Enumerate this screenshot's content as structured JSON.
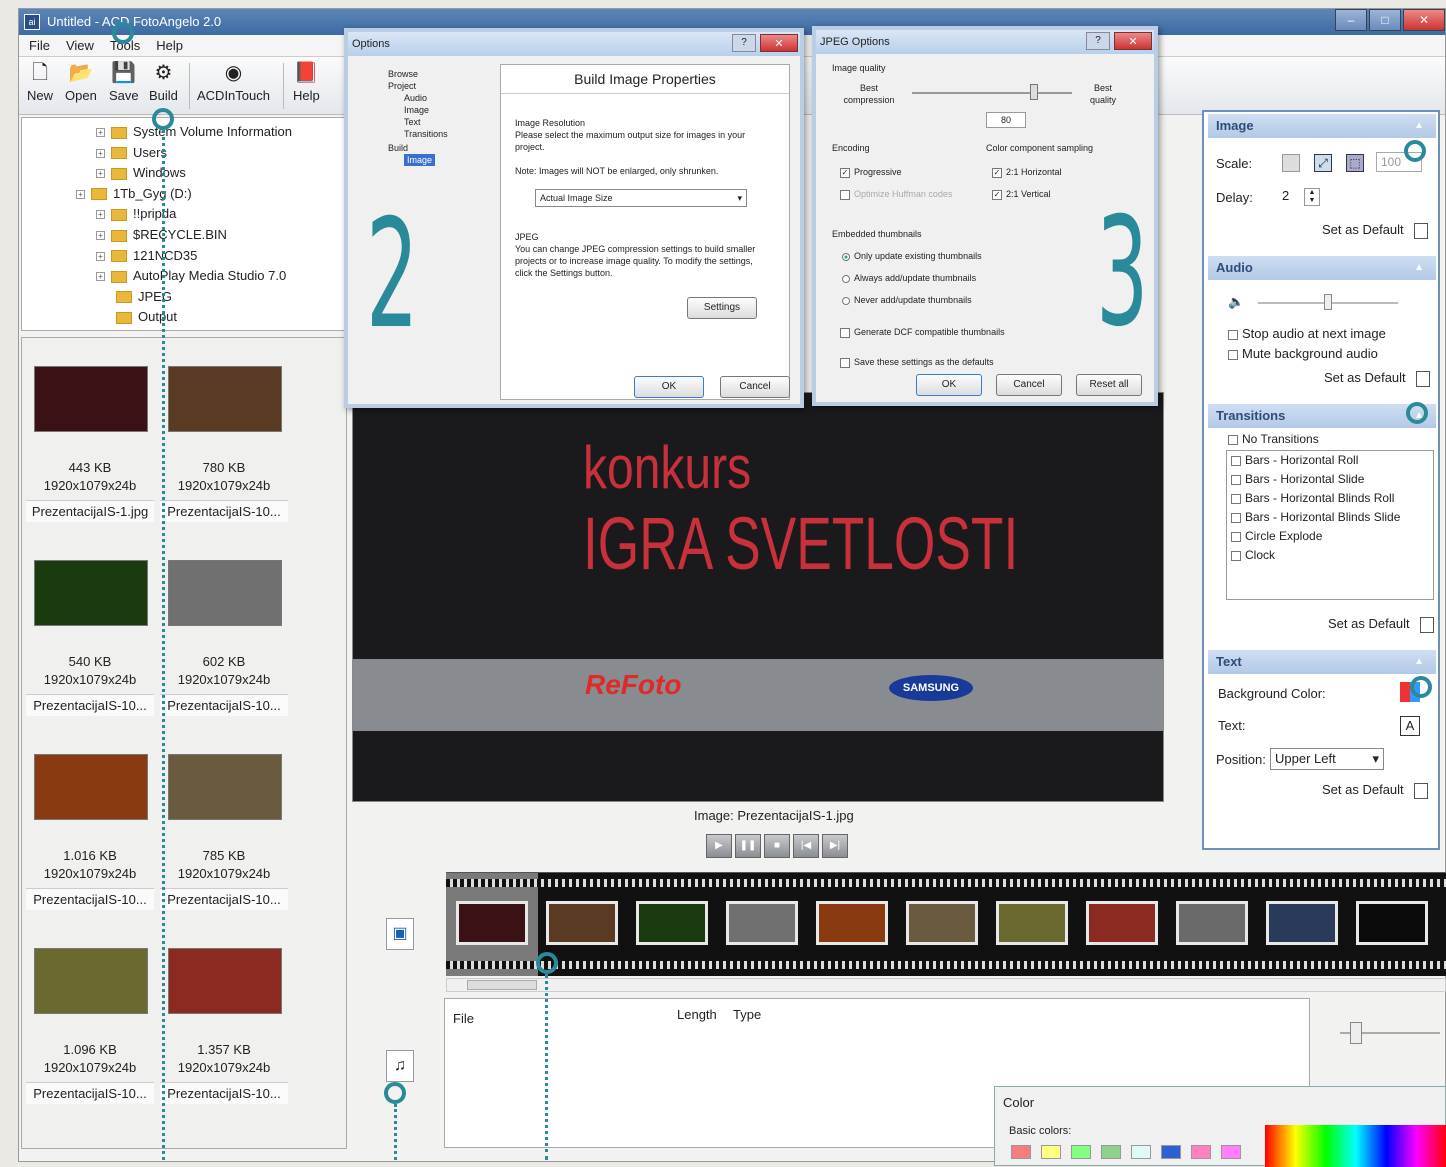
{
  "window": {
    "title": "Untitled - ACD FotoAngelo 2.0",
    "controls": [
      "–",
      "□",
      "✕"
    ]
  },
  "menu": [
    "File",
    "View",
    "Tools",
    "Help"
  ],
  "toolbar": {
    "buttons": [
      {
        "label": "New",
        "icon": "new-document-icon"
      },
      {
        "label": "Open",
        "icon": "open-folder-icon"
      },
      {
        "label": "Save",
        "icon": "save-disk-icon"
      },
      {
        "label": "Build",
        "icon": "build-icon"
      },
      {
        "label": "ACDInTouch",
        "icon": "acdintouch-icon"
      },
      {
        "label": "Help",
        "icon": "help-book-icon"
      }
    ]
  },
  "tree": {
    "items": [
      {
        "label": "System Volume Information",
        "indent": 1
      },
      {
        "label": "Users",
        "indent": 1
      },
      {
        "label": "Windows",
        "indent": 1
      },
      {
        "label": "1Tb_Gyg (D:)",
        "indent": 0
      },
      {
        "label": "!!pripda",
        "indent": 1
      },
      {
        "label": "$RECYCLE.BIN",
        "indent": 1
      },
      {
        "label": "121NCD35",
        "indent": 1
      },
      {
        "label": "AutoPlay Media Studio 7.0",
        "indent": 1
      },
      {
        "label": "JPEG",
        "indent": 2
      },
      {
        "label": "Output",
        "indent": 2
      }
    ]
  },
  "thumbnails": [
    {
      "size": "443 KB",
      "dims": "1920x1079x24b",
      "name": "PrezentacijaIS-1.jpg",
      "color": "#3a1216"
    },
    {
      "size": "780 KB",
      "dims": "1920x1079x24b",
      "name": "PrezentacijaIS-10...",
      "color": "#5a3a22"
    },
    {
      "size": "540 KB",
      "dims": "1920x1079x24b",
      "name": "PrezentacijaIS-10...",
      "color": "#1a3a10"
    },
    {
      "size": "602 KB",
      "dims": "1920x1079x24b",
      "name": "PrezentacijaIS-10...",
      "color": "#707070"
    },
    {
      "size": "1.016 KB",
      "dims": "1920x1079x24b",
      "name": "PrezentacijaIS-10...",
      "color": "#8a3a10"
    },
    {
      "size": "785 KB",
      "dims": "1920x1079x24b",
      "name": "PrezentacijaIS-10...",
      "color": "#6a5a40"
    },
    {
      "size": "1.096 KB",
      "dims": "1920x1079x24b",
      "name": "PrezentacijaIS-10...",
      "color": "#6a6a30"
    },
    {
      "size": "1.357 KB",
      "dims": "1920x1079x24b",
      "name": "PrezentacijaIS-10...",
      "color": "#8a2a20"
    }
  ],
  "preview": {
    "line1": "konkurs",
    "line2": "IGRA SVETLOSTI",
    "brand1": "ReFoto",
    "brand2": "SAMSUNG",
    "caption": "Image: PrezentacijaIS-1.jpg"
  },
  "playback": {
    "buttons": [
      "▶",
      "❚❚",
      "■",
      "|◀",
      "▶|"
    ]
  },
  "options_dialog": {
    "title": "Options",
    "tree": [
      "Browse",
      "Project",
      "Audio",
      "Image",
      "Text",
      "Transitions",
      "Build",
      "Image"
    ],
    "heading": "Build Image Properties",
    "res_label": "Image Resolution",
    "res_desc": "Please select the maximum output size for images in your project.",
    "note": "Note: Images will NOT be enlarged, only shrunken.",
    "select": "Actual Image Size",
    "jpeg_label": "JPEG",
    "jpeg_desc": "You can change JPEG compression settings to build smaller projects or to increase image quality. To modify the settings, click the Settings button.",
    "settings_btn": "Settings",
    "ok": "OK",
    "cancel": "Cancel",
    "marker": "2"
  },
  "jpeg_dialog": {
    "title": "JPEG Options",
    "quality_label": "Image quality",
    "best_compression": "Best compression",
    "best_quality": "Best quality",
    "quality_value": "80",
    "encoding": "Encoding",
    "progressive": "Progressive",
    "optimize": "Optimize Huffman codes",
    "sampling": "Color component sampling",
    "h": "2:1 Horizontal",
    "v": "2:1 Vertical",
    "embedded": "Embedded thumbnails",
    "r1": "Only update existing thumbnails",
    "r2": "Always add/update thumbnails",
    "r3": "Never add/update thumbnails",
    "dcf": "Generate DCF compatible thumbnails",
    "save_defaults": "Save these settings as the defaults",
    "ok": "OK",
    "cancel": "Cancel",
    "reset": "Reset all",
    "marker": "3"
  },
  "right_panel": {
    "image": {
      "header": "Image",
      "scale_label": "Scale:",
      "scale_value": "100",
      "delay_label": "Delay:",
      "delay_value": "2",
      "set_default": "Set as Default"
    },
    "audio": {
      "header": "Audio",
      "stop": "Stop audio at next image",
      "mute": "Mute background audio",
      "set_default": "Set as Default"
    },
    "transitions": {
      "header": "Transitions",
      "none": "No Transitions",
      "items": [
        "Bars - Horizontal Roll",
        "Bars - Horizontal Slide",
        "Bars - Horizontal Blinds Roll",
        "Bars - Horizontal Blinds Slide",
        "Circle Explode",
        "Clock"
      ],
      "set_default": "Set as Default"
    },
    "text": {
      "header": "Text",
      "bg_label": "Background Color:",
      "text_label": "Text:",
      "text_icon": "A",
      "pos_label": "Position:",
      "pos_value": "Upper Left",
      "set_default": "Set as Default"
    }
  },
  "audio_pane": {
    "col_file": "File",
    "col_length": "Length",
    "col_type": "Type"
  },
  "color_dialog": {
    "title": "Color",
    "basic": "Basic colors:",
    "swatches": [
      "#f28080",
      "#ffff80",
      "#80ff80",
      "#8fd08f",
      "#dff8f8",
      "#3060d0",
      "#ff80c0",
      "#ff80ff"
    ]
  },
  "filmstrip": {
    "colors": [
      "#3a1216",
      "#5a3a22",
      "#1a3a10",
      "#707070",
      "#8a3a10",
      "#6a5a40",
      "#6a6a30",
      "#8a2a20",
      "#6a6a6a",
      "#2a3a5a",
      "#0a0a0a"
    ]
  }
}
